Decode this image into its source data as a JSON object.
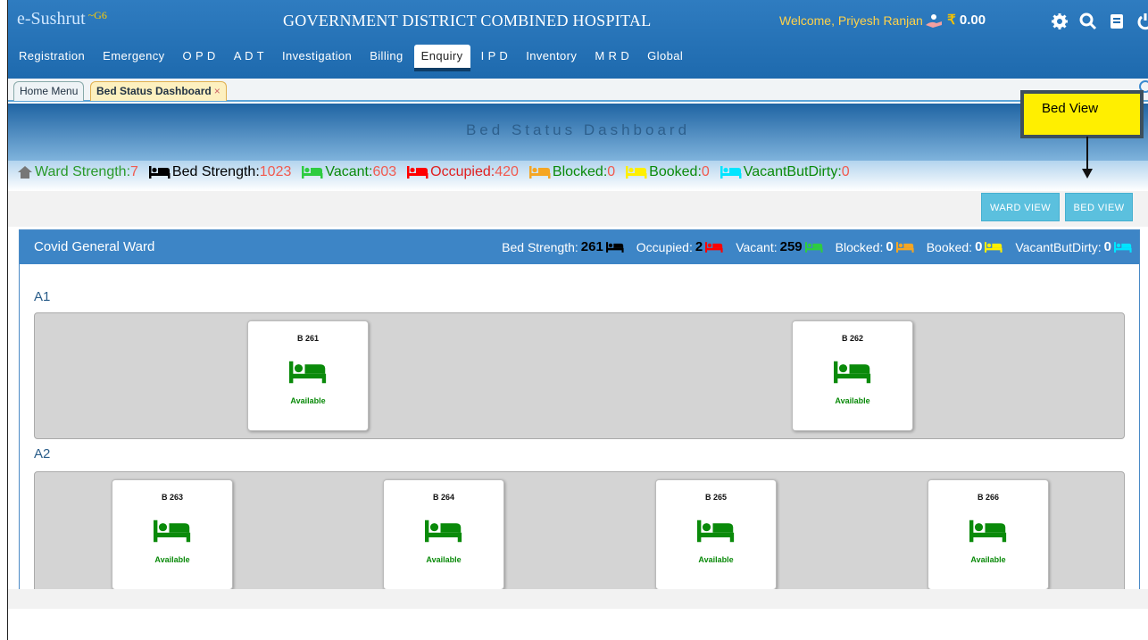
{
  "app": {
    "brand": "e-Sushrut",
    "brand_version": "~G6",
    "hospital": "GOVERNMENT DISTRICT COMBINED HOSPITAL",
    "welcome": "Welcome, Priyesh Ranjan",
    "wallet": "₹",
    "wallet_amount": "0.00"
  },
  "menu": [
    "Registration",
    "Emergency",
    "O P D",
    "A D T",
    "Investigation",
    "Billing",
    "Enquiry",
    "I P D",
    "Inventory",
    "M R D",
    "Global"
  ],
  "active_menu": "Enquiry",
  "tabs": {
    "home": "Home Menu",
    "active": "Bed Status Dashboard",
    "close": "×"
  },
  "dashboard_title": "Bed Status Dashboard",
  "summary": {
    "ward_strength_label": "Ward Strength:",
    "ward_strength": "7",
    "bed_strength_label": "Bed Strength:",
    "bed_strength": "1023",
    "vacant_label": "Vacant:",
    "vacant": "603",
    "occupied_label": "Occupied:",
    "occupied": "420",
    "blocked_label": "Blocked:",
    "blocked": "0",
    "booked_label": "Booked:",
    "booked": "0",
    "dirty_label": "VacantButDirty:",
    "dirty": "0"
  },
  "callout": "Bed View",
  "buttons": {
    "ward_view": "WARD VIEW",
    "bed_view": "BED VIEW"
  },
  "ward": {
    "name": "Covid General Ward",
    "bed_strength_label": "Bed Strength:",
    "bed_strength": "261",
    "occupied_label": "Occupied:",
    "occupied": "2",
    "vacant_label": "Vacant:",
    "vacant": "259",
    "blocked_label": "Blocked:",
    "blocked": "0",
    "booked_label": "Booked:",
    "booked": "0",
    "dirty_label": "VacantButDirty:",
    "dirty": "0"
  },
  "groups": [
    {
      "name": "A1",
      "beds": [
        {
          "no": "B 261",
          "status": "Available"
        },
        {
          "no": "B 262",
          "status": "Available"
        }
      ]
    },
    {
      "name": "A2",
      "beds": [
        {
          "no": "B 263",
          "status": "Available"
        },
        {
          "no": "B 264",
          "status": "Available"
        },
        {
          "no": "B 265",
          "status": "Available"
        },
        {
          "no": "B 266",
          "status": "Available"
        }
      ]
    }
  ],
  "colors": {
    "bed_strength": "#000000",
    "vacant": "#2ecc40",
    "occupied": "#ff0000",
    "blocked": "#f5a623",
    "booked": "#ffef00",
    "dirty": "#00e5ff",
    "available": "#0a8a0a"
  }
}
